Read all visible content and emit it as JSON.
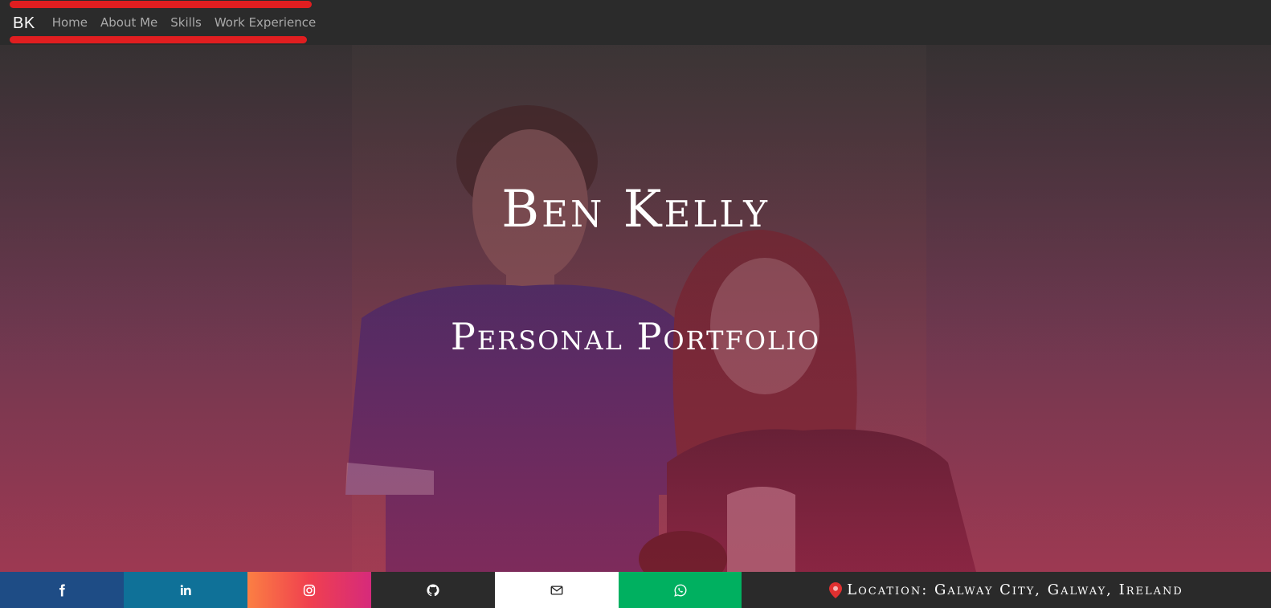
{
  "navbar": {
    "brand": "BK",
    "links": [
      "Home",
      "About Me",
      "Skills",
      "Work Experience"
    ],
    "accent_color": "#e01e20"
  },
  "hero": {
    "title": "Ben Kelly",
    "subtitle": "Personal Portfolio"
  },
  "footer": {
    "socials": [
      {
        "name": "facebook",
        "icon": "facebook-icon",
        "color": "#1e4c85"
      },
      {
        "name": "linkedin",
        "icon": "linkedin-icon",
        "color": "#0f7198"
      },
      {
        "name": "instagram",
        "icon": "instagram-icon",
        "color": "#f0404f"
      },
      {
        "name": "github",
        "icon": "github-icon",
        "color": "#2b2b2b"
      },
      {
        "name": "email",
        "icon": "envelope-icon",
        "color": "#ffffff"
      },
      {
        "name": "whatsapp",
        "icon": "whatsapp-icon",
        "color": "#00b060"
      }
    ],
    "location": "Location: Galway City, Galway, Ireland",
    "pin_color": "#e03030"
  }
}
